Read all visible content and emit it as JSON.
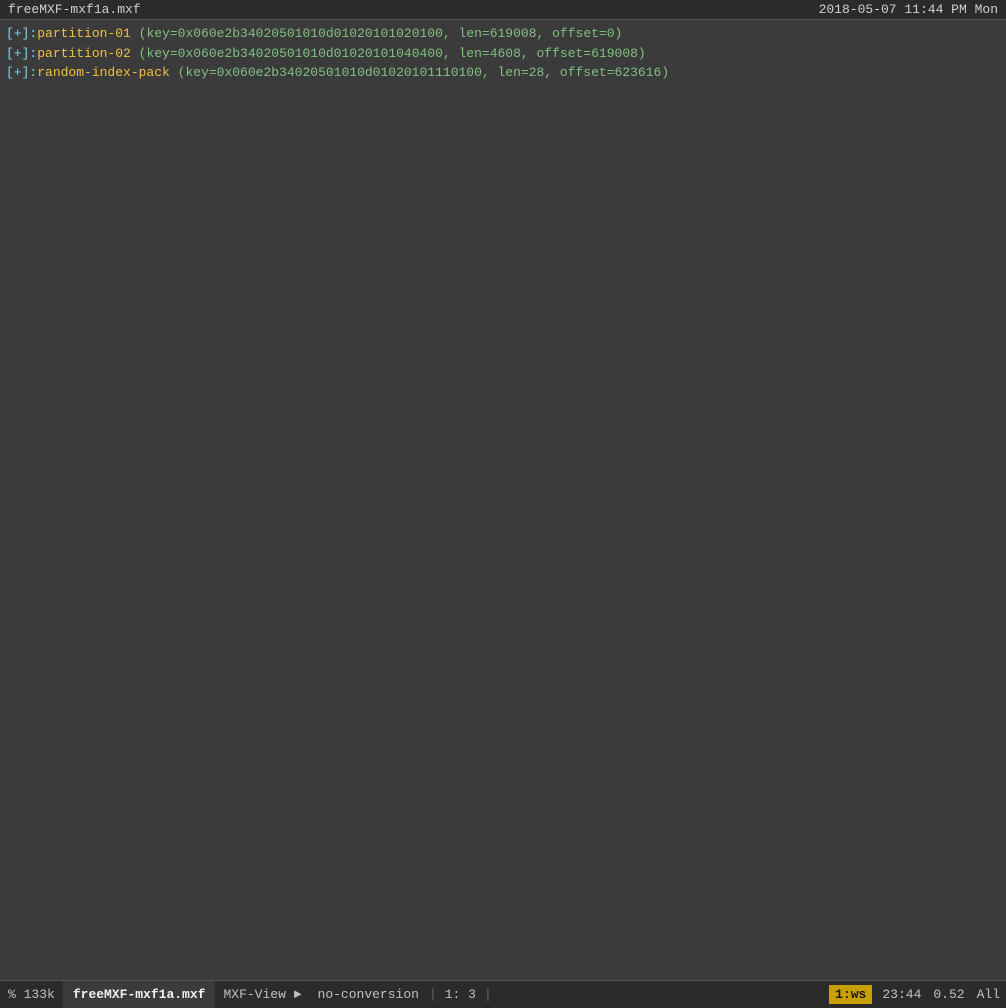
{
  "titleBar": {
    "filename": "freeMXF-mxf1a.mxf",
    "datetime": "2018-05-07  11:44 PM Mon"
  },
  "lines": [
    {
      "prefix": "[+]",
      "colon": ":",
      "key": "partition-01",
      "params": " (key=0x060e2b34020501010d01020101020100, len=619008, offset=0)"
    },
    {
      "prefix": "[+]",
      "colon": ":",
      "key": "partition-02",
      "params": " (key=0x060e2b34020501010d01020101040400, len=4608, offset=619008)"
    },
    {
      "prefix": "[+]",
      "colon": ":",
      "key": "random-index-pack",
      "params": " (key=0x060e2b34020501010d01020101110100, len=28, offset=623616)"
    }
  ],
  "statusBar": {
    "percent": "%",
    "size": "133k",
    "filename": "freeMXF-mxf1a.mxf",
    "mode": "MXF-View",
    "arrow": "►",
    "noConversion": "no-conversion",
    "pipe1": "|",
    "position": "1: 3",
    "pipe2": "|",
    "wsLabel": "1:ws",
    "time": "23:44",
    "score": "0.52",
    "all": "All"
  }
}
